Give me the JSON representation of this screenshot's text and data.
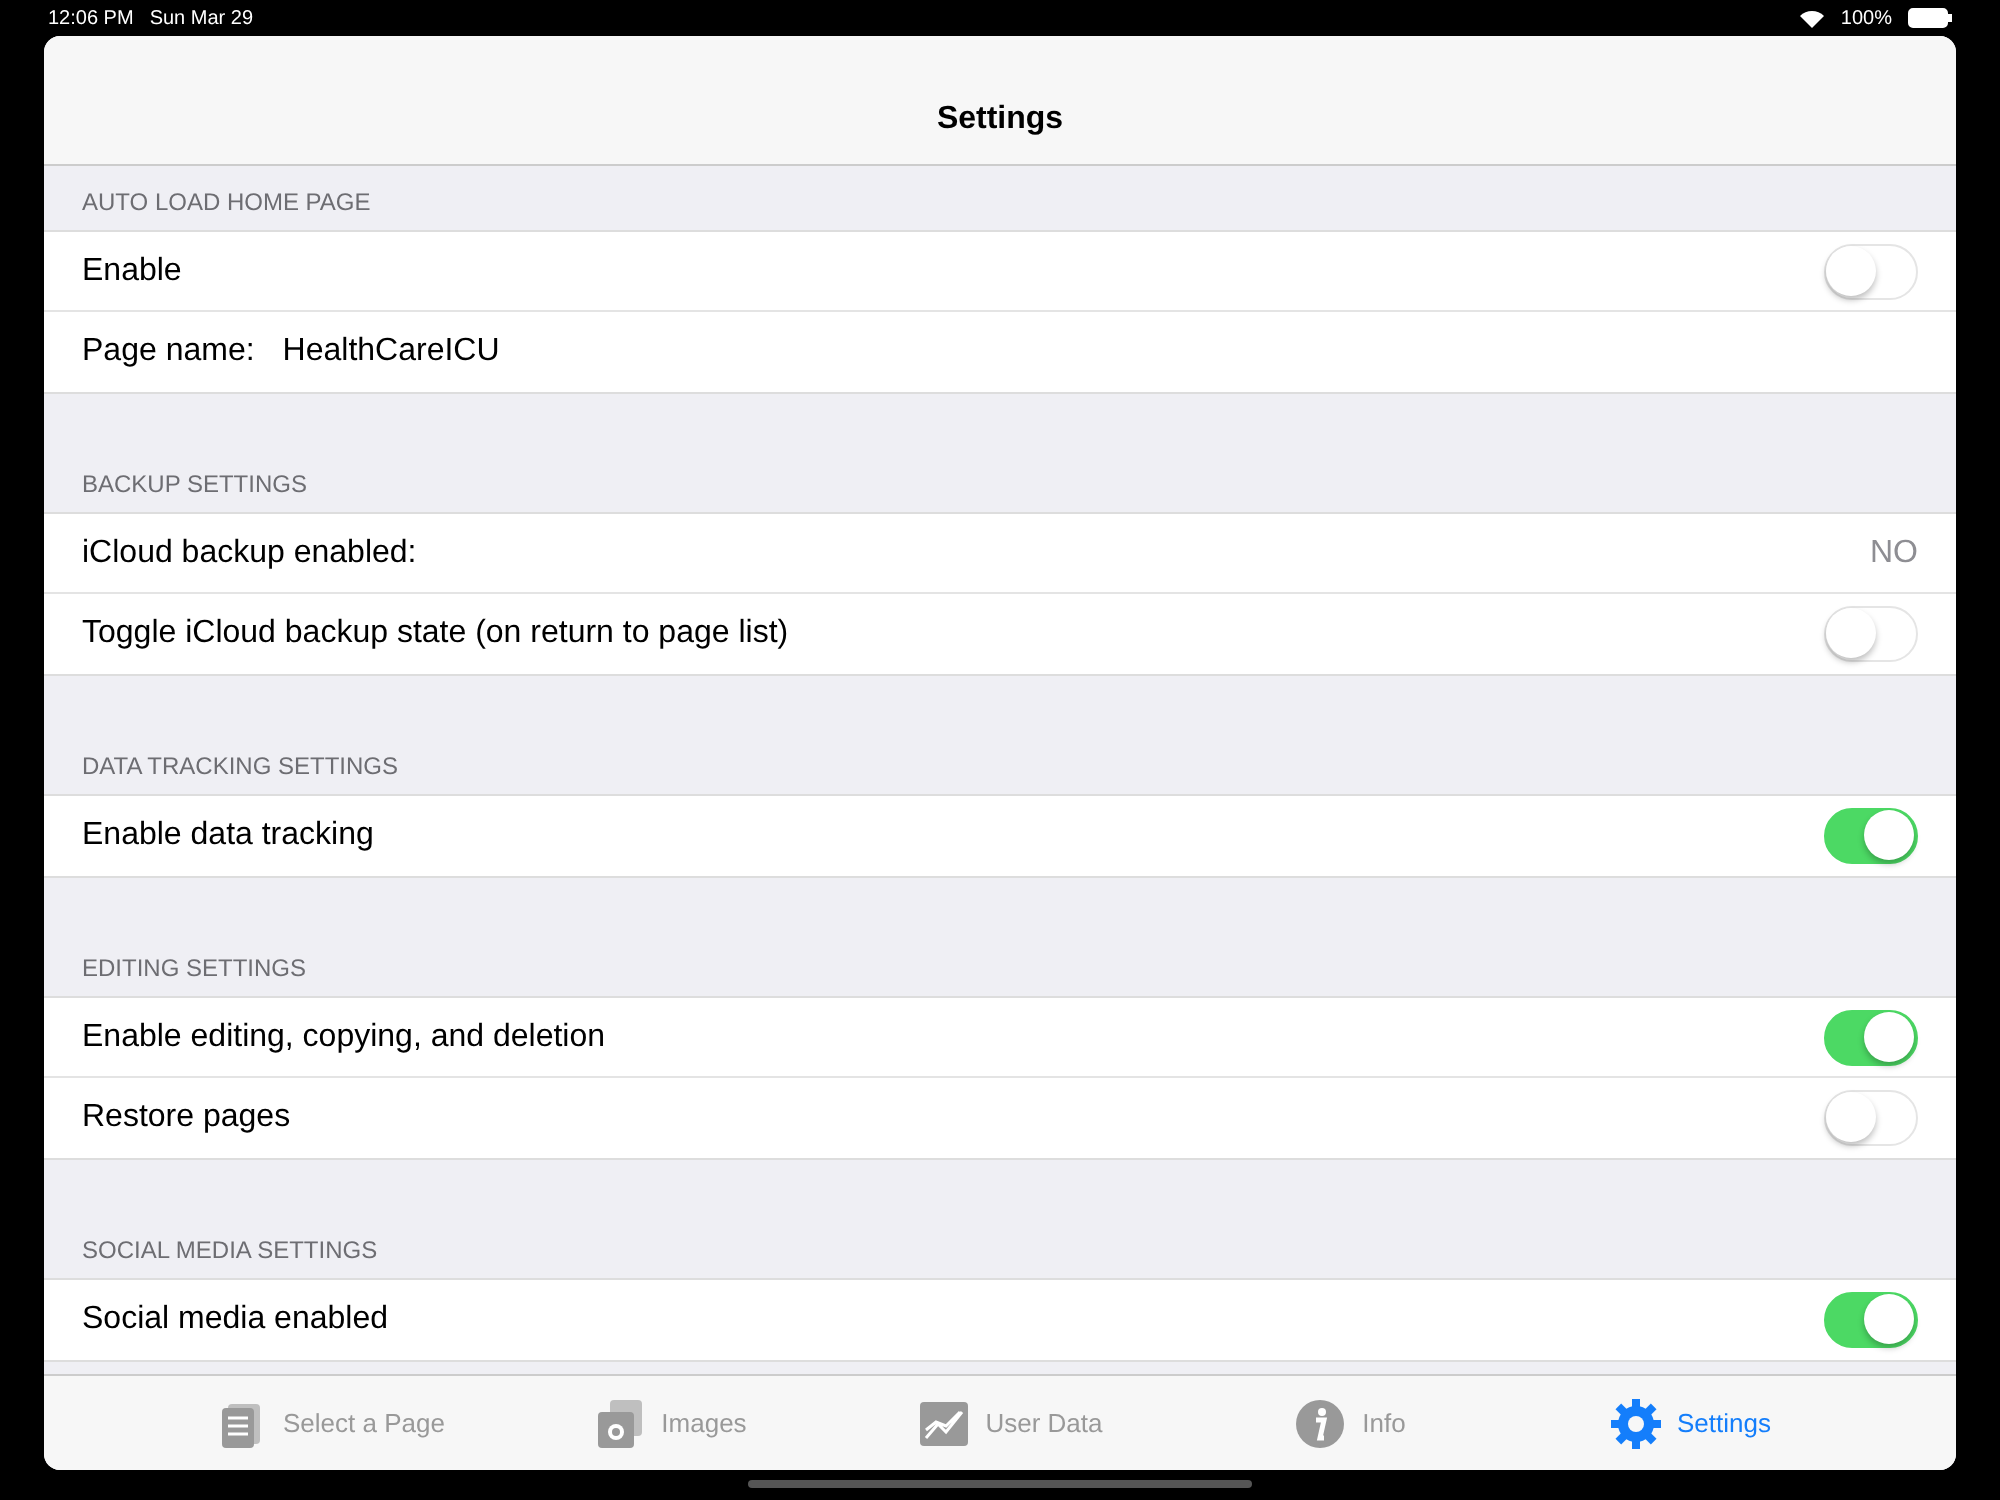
{
  "status_bar": {
    "time": "12:06 PM",
    "date": "Sun Mar 29",
    "battery": "100%"
  },
  "nav_bar": {
    "title": "Settings"
  },
  "sections": [
    {
      "header": "AUTO LOAD HOME PAGE",
      "rows": [
        {
          "kind": "toggle",
          "label": "Enable",
          "on": false
        },
        {
          "kind": "field",
          "label": "Page name:",
          "value": "HealthCareICU"
        }
      ]
    },
    {
      "header": "BACKUP SETTINGS",
      "rows": [
        {
          "kind": "detail",
          "label": "iCloud backup enabled:",
          "value": "NO"
        },
        {
          "kind": "toggle",
          "label": "Toggle iCloud backup state (on return to page list)",
          "on": false
        }
      ]
    },
    {
      "header": "DATA TRACKING SETTINGS",
      "rows": [
        {
          "kind": "toggle",
          "label": "Enable data tracking",
          "on": true
        }
      ]
    },
    {
      "header": "EDITING SETTINGS",
      "rows": [
        {
          "kind": "toggle",
          "label": "Enable editing, copying, and deletion",
          "on": true
        },
        {
          "kind": "toggle",
          "label": "Restore pages",
          "on": false
        }
      ]
    },
    {
      "header": "SOCIAL MEDIA SETTINGS",
      "rows": [
        {
          "kind": "toggle",
          "label": "Social media enabled",
          "on": true
        }
      ]
    }
  ],
  "tab_bar": [
    {
      "kind": "pages",
      "label": "Select a Page",
      "selected": false
    },
    {
      "kind": "images",
      "label": "Images",
      "selected": false
    },
    {
      "kind": "chart",
      "label": "User Data",
      "selected": false
    },
    {
      "kind": "info",
      "label": "Info",
      "selected": false
    },
    {
      "kind": "gear",
      "label": "Settings",
      "selected": true
    }
  ]
}
